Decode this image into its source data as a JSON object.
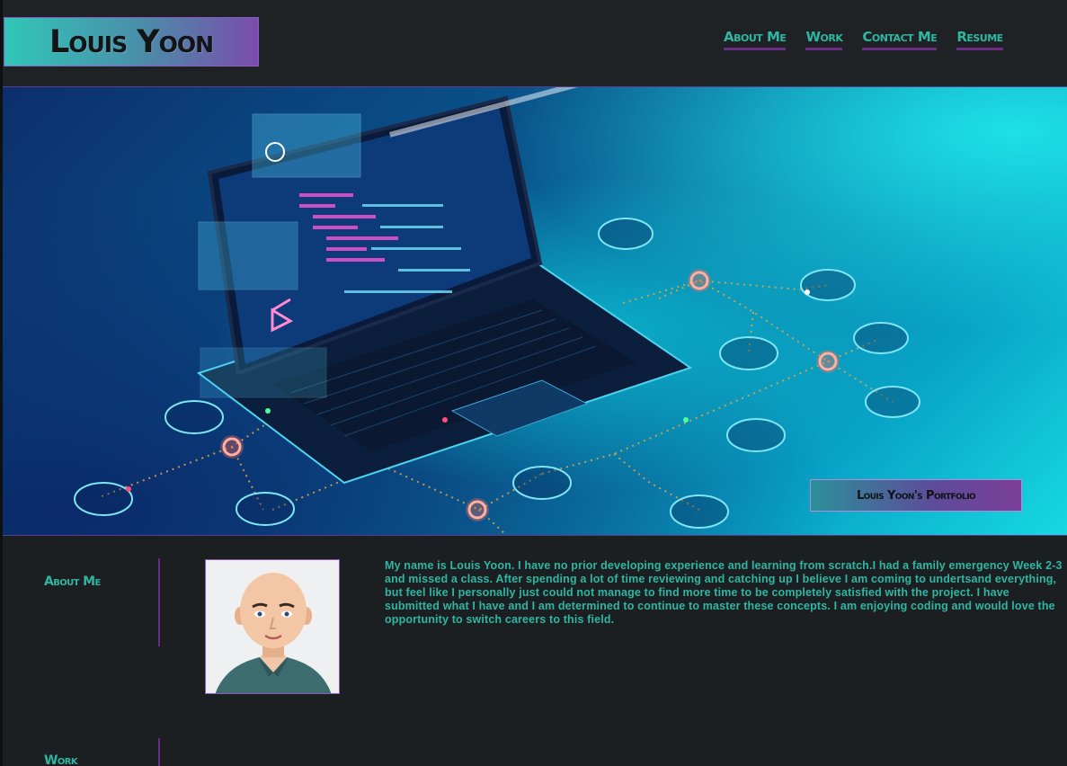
{
  "header": {
    "logo_text": "Louis Yoon",
    "nav": [
      {
        "label": "About Me"
      },
      {
        "label": "Work"
      },
      {
        "label": "Contact Me"
      },
      {
        "label": "Resume"
      }
    ]
  },
  "hero": {
    "image_icon": "laptop-network-illustration",
    "badge_text": "Louis Yoon's Portfolio"
  },
  "about": {
    "label": "About Me",
    "avatar_icon": "cartoon-avatar-icon",
    "bio": "My name is Louis Yoon. I have no prior developing experience and learning from scratch.I had a family emergency Week 2-3 and missed a class. After spending a lot of time reviewing and catching up I believe I am coming to undertsand everything, but feel like I personally just could not manage to find more time to be completely satisfied with the project. I have submitted what I have and I am determined to continue to master these concepts. I am enjoying coding and would love the opportunity to switch careers to this field."
  },
  "work": {
    "label": "Work"
  },
  "colors": {
    "background": "#1c1f21",
    "accent_teal": "#2fb6a2",
    "accent_purple": "#6b2b84"
  }
}
